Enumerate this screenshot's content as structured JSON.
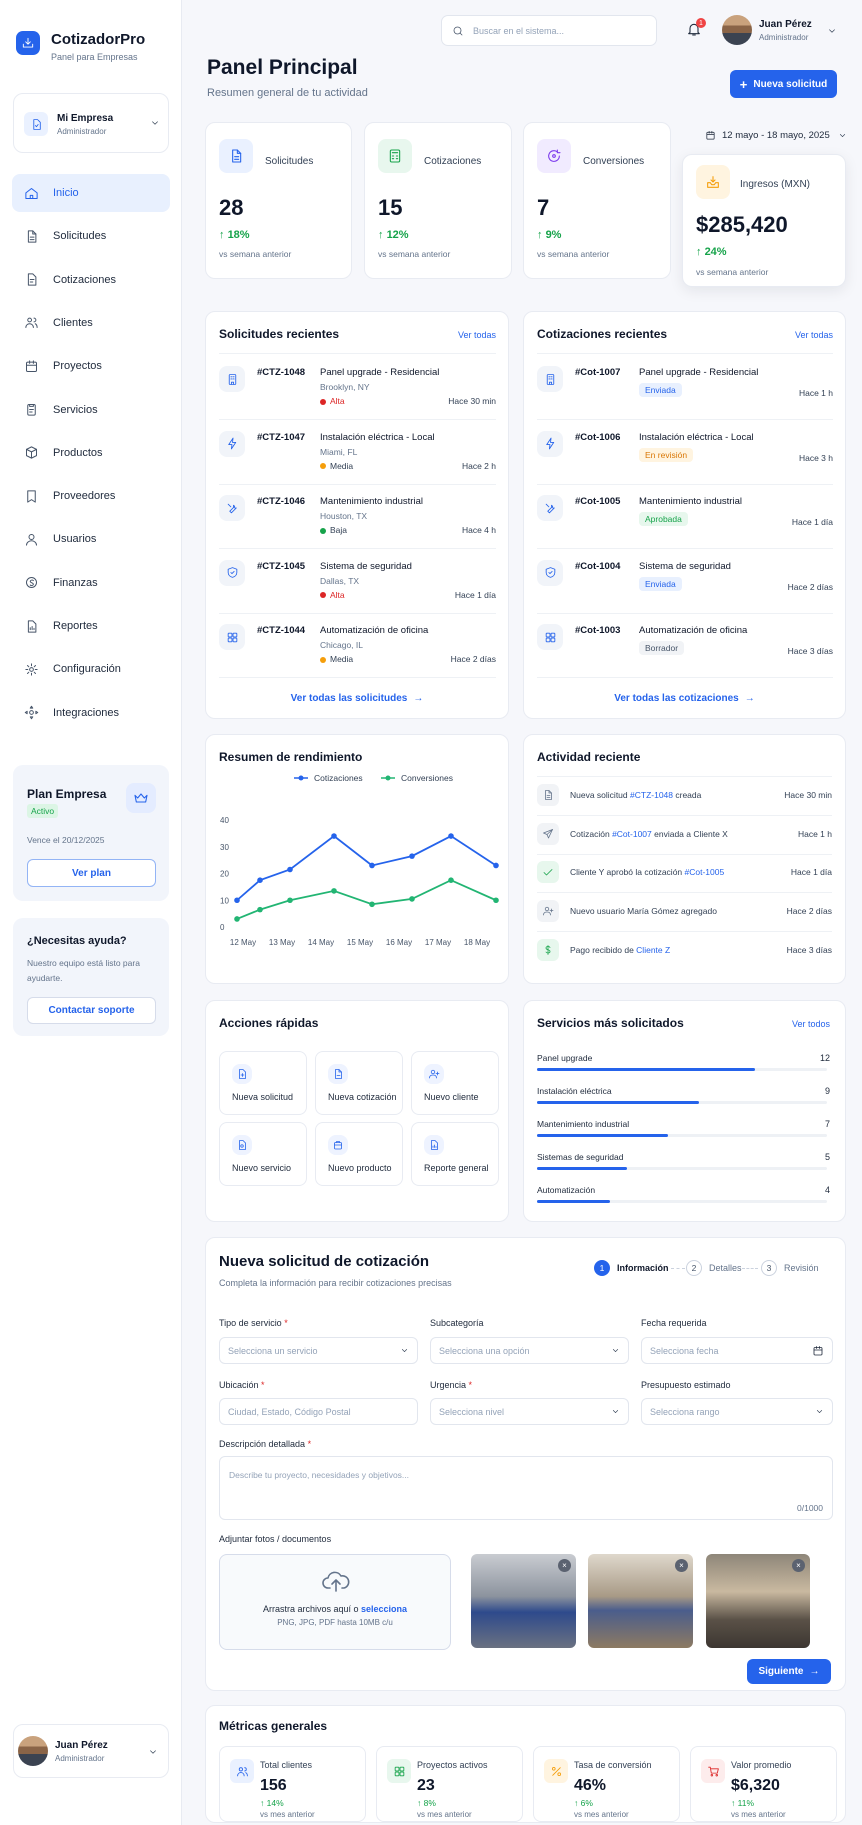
{
  "brand": {
    "name": "CotizadorPro",
    "subtitle": "Panel para Empresas",
    "accent": "#2563eb"
  },
  "company": {
    "name": "Mi Empresa",
    "role": "Administrador"
  },
  "nav": [
    {
      "label": "Inicio",
      "icon": "home-icon",
      "active": true
    },
    {
      "label": "Solicitudes",
      "icon": "file-icon"
    },
    {
      "label": "Cotizaciones",
      "icon": "document-icon"
    },
    {
      "label": "Clientes",
      "icon": "users-icon"
    },
    {
      "label": "Proyectos",
      "icon": "calendar-icon"
    },
    {
      "label": "Servicios",
      "icon": "clipboard-icon"
    },
    {
      "label": "Productos",
      "icon": "box-icon"
    },
    {
      "label": "Proveedores",
      "icon": "bookmark-icon"
    },
    {
      "label": "Usuarios",
      "icon": "user-icon"
    },
    {
      "label": "Finanzas",
      "icon": "coin-icon"
    },
    {
      "label": "Reportes",
      "icon": "report-icon"
    },
    {
      "label": "Configuración",
      "icon": "gear-icon"
    },
    {
      "label": "Integraciones",
      "icon": "plug-icon"
    }
  ],
  "plan": {
    "title": "Plan Empresa",
    "status": "Activo",
    "expiry": "Vence el 20/12/2025",
    "button": "Ver plan"
  },
  "help": {
    "title": "¿Necesitas ayuda?",
    "text1": "Nuestro equipo está listo para",
    "text2": "ayudarte.",
    "button": "Contactar soporte"
  },
  "sidebar_user": {
    "name": "Juan Pérez",
    "role": "Administrador"
  },
  "topbar": {
    "search_placeholder": "Buscar en el sistema...",
    "notif_count": "1",
    "user_name": "Juan Pérez",
    "user_role": "Administrador"
  },
  "header": {
    "title": "Panel Principal",
    "subtitle": "Resumen general de tu actividad",
    "new_button": "Nueva solicitud",
    "date_range": "12 mayo - 18 mayo, 2025"
  },
  "stats": [
    {
      "label": "Solicitudes",
      "value": "28",
      "delta": "18%",
      "note": "vs semana anterior",
      "icon": "file-icon",
      "color": "#2563eb",
      "bg": "#eaf1ff"
    },
    {
      "label": "Cotizaciones",
      "value": "15",
      "delta": "12%",
      "note": "vs semana anterior",
      "icon": "calculator-icon",
      "color": "#16a34a",
      "bg": "#e8f7ee"
    },
    {
      "label": "Conversiones",
      "value": "7",
      "delta": "9%",
      "note": "vs semana anterior",
      "icon": "cycle-icon",
      "color": "#7c3aed",
      "bg": "#f1ebff"
    },
    {
      "label": "Ingresos (MXN)",
      "value": "$285,420",
      "delta": "24%",
      "note": "vs semana anterior",
      "icon": "inbox-icon",
      "color": "#f59e0b",
      "bg": "#fff4e0"
    }
  ],
  "requests": {
    "title": "Solicitudes recientes",
    "link": "Ver todas",
    "footer": "Ver todas las solicitudes",
    "items": [
      {
        "id": "#CTZ-1048",
        "title": "Panel upgrade - Residencial",
        "location": "Brooklyn, NY",
        "priority": "Alta",
        "pcolor": "#dc2626",
        "time": "Hace 30 min",
        "icon": "building-icon"
      },
      {
        "id": "#CTZ-1047",
        "title": "Instalación eléctrica - Local",
        "location": "Miami, FL",
        "priority": "Media",
        "pcolor": "#f59e0b",
        "time": "Hace 2 h",
        "icon": "bolt-icon"
      },
      {
        "id": "#CTZ-1046",
        "title": "Mantenimiento industrial",
        "location": "Houston, TX",
        "priority": "Baja",
        "pcolor": "#16a34a",
        "time": "Hace 4 h",
        "icon": "tools-icon"
      },
      {
        "id": "#CTZ-1045",
        "title": "Sistema de seguridad",
        "location": "Dallas, TX",
        "priority": "Alta",
        "pcolor": "#dc2626",
        "time": "Hace 1 día",
        "icon": "shield-icon"
      },
      {
        "id": "#CTZ-1044",
        "title": "Automatización de oficina",
        "location": "Chicago, IL",
        "priority": "Media",
        "pcolor": "#f59e0b",
        "time": "Hace 2 días",
        "icon": "grid-icon"
      }
    ]
  },
  "quotes": {
    "title": "Cotizaciones recientes",
    "link": "Ver todas",
    "footer": "Ver todas las cotizaciones",
    "items": [
      {
        "id": "#Cot-1007",
        "title": "Panel upgrade - Residencial",
        "status": "Enviada",
        "sbg": "#e8f0fe",
        "sfg": "#2563eb",
        "time": "Hace 1 h",
        "icon": "building-icon"
      },
      {
        "id": "#Cot-1006",
        "title": "Instalación eléctrica - Local",
        "status": "En revisión",
        "sbg": "#fff4e0",
        "sfg": "#d97706",
        "time": "Hace 3 h",
        "icon": "bolt-icon"
      },
      {
        "id": "#Cot-1005",
        "title": "Mantenimiento industrial",
        "status": "Aprobada",
        "sbg": "#e7f7ed",
        "sfg": "#16a34a",
        "time": "Hace 1 día",
        "icon": "tools-icon"
      },
      {
        "id": "#Cot-1004",
        "title": "Sistema de seguridad",
        "status": "Enviada",
        "sbg": "#e8f0fe",
        "sfg": "#2563eb",
        "time": "Hace 2 días",
        "icon": "shield-icon"
      },
      {
        "id": "#Cot-1003",
        "title": "Automatización de oficina",
        "status": "Borrador",
        "sbg": "#f1f3f6",
        "sfg": "#475569",
        "time": "Hace 3 días",
        "icon": "grid-icon"
      }
    ]
  },
  "chart_data": {
    "type": "line",
    "title": "Resumen de rendimiento",
    "categories": [
      "12 May",
      "13 May",
      "14 May",
      "15 May",
      "16 May",
      "17 May",
      "18 May"
    ],
    "series": [
      {
        "name": "Cotizaciones",
        "color": "#2563eb",
        "values": [
          10,
          17.5,
          21.5,
          34,
          23,
          26.5,
          34,
          23
        ]
      },
      {
        "name": "Conversiones",
        "color": "#22b573",
        "values": [
          3,
          6.5,
          10,
          13.5,
          8.5,
          10.5,
          17.5,
          10
        ]
      }
    ],
    "x_points": [
      "12 May",
      "",
      "13 May",
      "14 May",
      "15 May",
      "16 May",
      "17 May",
      "18 May"
    ],
    "yticks": [
      0,
      10,
      20,
      30,
      40
    ],
    "ylim": [
      0,
      40
    ],
    "legend": "top"
  },
  "activity": {
    "title": "Actividad reciente",
    "items": [
      {
        "pre": "Nueva solicitud ",
        "link": "#CTZ-1048",
        "post": " creada",
        "time": "Hace 30 min",
        "icon": "file-icon",
        "color": "#64748b",
        "bg": "#f1f3f6"
      },
      {
        "pre": "Cotización ",
        "link": "#Cot-1007",
        "post": " enviada a Cliente X",
        "time": "Hace 1 h",
        "icon": "send-icon",
        "color": "#64748b",
        "bg": "#f1f3f6"
      },
      {
        "pre": "Cliente Y aprobó la cotización ",
        "link": "#Cot-1005",
        "post": "",
        "time": "Hace 1 día",
        "icon": "check-icon",
        "color": "#16a34a",
        "bg": "#e7f7ed"
      },
      {
        "pre": "Nuevo usuario María Gómez agregado",
        "link": "",
        "post": "",
        "time": "Hace 2 días",
        "icon": "user-plus-icon",
        "color": "#64748b",
        "bg": "#f1f3f6"
      },
      {
        "pre": "Pago recibido de ",
        "link": "Cliente Z",
        "post": "",
        "time": "Hace 3 días",
        "icon": "dollar-icon",
        "color": "#16a34a",
        "bg": "#e7f7ed"
      }
    ]
  },
  "quick": {
    "title": "Acciones rápidas",
    "items": [
      {
        "label": "Nueva solicitud",
        "icon": "file-plus-icon"
      },
      {
        "label": "Nueva cotización",
        "icon": "document-plus-icon"
      },
      {
        "label": "Nuevo cliente",
        "icon": "user-plus-icon"
      },
      {
        "label": "Nuevo servicio",
        "icon": "service-icon"
      },
      {
        "label": "Nuevo producto",
        "icon": "package-icon"
      },
      {
        "label": "Reporte general",
        "icon": "report-icon"
      }
    ]
  },
  "services": {
    "title": "Servicios más solicitados",
    "link": "Ver todos",
    "items": [
      {
        "name": "Panel upgrade",
        "count": "12",
        "pct": 0.75
      },
      {
        "name": "Instalación eléctrica",
        "count": "9",
        "pct": 0.56
      },
      {
        "name": "Mantenimiento industrial",
        "count": "7",
        "pct": 0.45
      },
      {
        "name": "Sistemas de seguridad",
        "count": "5",
        "pct": 0.31
      },
      {
        "name": "Automatización",
        "count": "4",
        "pct": 0.25
      }
    ]
  },
  "form": {
    "title": "Nueva solicitud de cotización",
    "subtitle": "Completa la información para recibir cotizaciones precisas",
    "steps": [
      {
        "n": "1",
        "label": "Información",
        "active": true
      },
      {
        "n": "2",
        "label": "Detalles"
      },
      {
        "n": "3",
        "label": "Revisión"
      }
    ],
    "fields": [
      {
        "label": "Tipo de servicio",
        "req": true,
        "placeholder": "Selecciona un servicio",
        "kind": "select"
      },
      {
        "label": "Subcategoría",
        "req": false,
        "placeholder": "Selecciona una opción",
        "kind": "select"
      },
      {
        "label": "Fecha requerida",
        "req": false,
        "placeholder": "Selecciona fecha",
        "kind": "date"
      },
      {
        "label": "Ubicación",
        "req": true,
        "placeholder": "Ciudad, Estado, Código Postal",
        "kind": "text"
      },
      {
        "label": "Urgencia",
        "req": true,
        "placeholder": "Selecciona nivel",
        "kind": "select"
      },
      {
        "label": "Presupuesto estimado",
        "req": false,
        "placeholder": "Selecciona rango",
        "kind": "select"
      }
    ],
    "description_label": "Descripción detallada",
    "description_placeholder": "Describe tu proyecto, necesidades y objetivos...",
    "counter": "0/1000",
    "attach_label": "Adjuntar fotos / documentos",
    "drop_text": "Arrastra archivos aquí o ",
    "drop_link": "selecciona",
    "drop_hint": "PNG, JPG, PDF hasta 10MB c/u",
    "next": "Siguiente"
  },
  "metrics": {
    "title": "Métricas generales",
    "items": [
      {
        "label": "Total clientes",
        "value": "156",
        "delta": "14%",
        "note": "vs mes anterior",
        "icon": "users-icon",
        "color": "#2563eb",
        "bg": "#eaf1ff"
      },
      {
        "label": "Proyectos activos",
        "value": "23",
        "delta": "8%",
        "note": "vs mes anterior",
        "icon": "grid-icon",
        "color": "#16a34a",
        "bg": "#e8f7ee"
      },
      {
        "label": "Tasa de conversión",
        "value": "46%",
        "delta": "6%",
        "note": "vs mes anterior",
        "icon": "percent-icon",
        "color": "#f59e0b",
        "bg": "#fff4e0"
      },
      {
        "label": "Valor promedio",
        "value": "$6,320",
        "delta": "11%",
        "note": "vs mes anterior",
        "icon": "cart-icon",
        "color": "#dc2626",
        "bg": "#fdecec"
      }
    ]
  }
}
